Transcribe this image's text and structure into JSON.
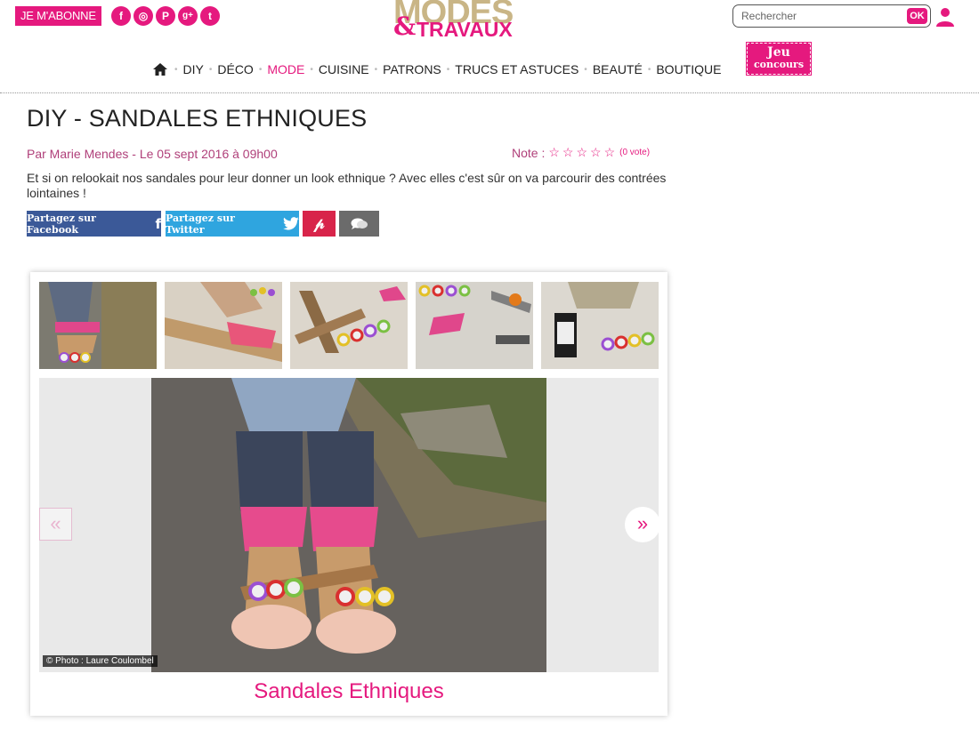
{
  "header": {
    "subscribe_label": "JE M'ABONNE",
    "social": [
      {
        "icon": "facebook-icon",
        "glyph": "f"
      },
      {
        "icon": "instagram-icon",
        "glyph": "◎"
      },
      {
        "icon": "pinterest-icon",
        "glyph": "P"
      },
      {
        "icon": "google-plus-icon",
        "glyph": "g+"
      },
      {
        "icon": "twitter-icon",
        "glyph": "t"
      }
    ],
    "logo_top": "MODES",
    "logo_amp": "&",
    "logo_bottom": "TRAVAUX",
    "search_placeholder": "Rechercher",
    "search_button": "OK"
  },
  "nav": {
    "items": [
      "DIY",
      "DÉCO",
      "MODE",
      "CUISINE",
      "PATRONS",
      "TRUCS ET ASTUCES",
      "BEAUTÉ",
      "BOUTIQUE"
    ],
    "active": "MODE",
    "contest_line1": "Jeu",
    "contest_line2": "concours"
  },
  "article": {
    "title": "DIY - SANDALES ETHNIQUES",
    "byline": "Par Marie Mendes - Le 05 sept 2016 à 09h00",
    "rating_label": "Note :",
    "rating_stars": "☆☆☆☆☆",
    "rating_votes": "(0 vote)",
    "intro": "Et si on relookait nos sandales pour leur donner un look ethnique ? Avec elles c'est sûr on va parcourir des contrées lointaines !"
  },
  "share": {
    "facebook": "Partagez sur Facebook",
    "twitter": "Partagez sur Twitter"
  },
  "gallery": {
    "credit": "© Photo : Laure Coulombel",
    "caption": "Sandales Ethniques",
    "prev": "«",
    "next": "»"
  },
  "colors": {
    "accent": "#e5197e",
    "facebook": "#3b5998",
    "twitter": "#2fa5df",
    "pinterest": "#d8244a"
  }
}
